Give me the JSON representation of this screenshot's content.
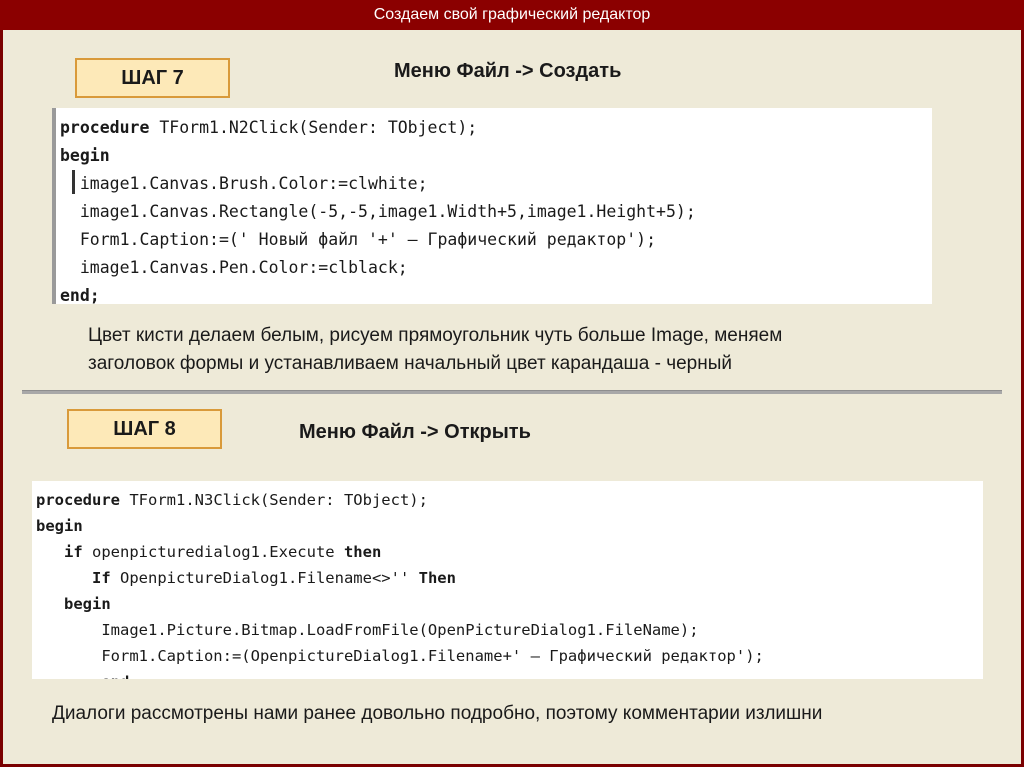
{
  "title": "Создаем свой графический редактор",
  "step7": {
    "label": "ШАГ 7",
    "menu": "Меню Файл -> Создать",
    "code": [
      [
        {
          "t": "procedure",
          "b": true
        },
        {
          "t": " TForm1.N2Click(Sender: TObject);",
          "b": false
        }
      ],
      [
        {
          "t": "begin",
          "b": true
        }
      ],
      [
        {
          "t": "  image1.Canvas.Brush.Color:=clwhite;",
          "b": false
        }
      ],
      [
        {
          "t": "  image1.Canvas.Rectangle(-5,-5,image1.Width+5,image1.Height+5);",
          "b": false
        }
      ],
      [
        {
          "t": "  Form1.Caption:=(' Новый файл '+' – Графический редактор');",
          "b": false
        }
      ],
      [
        {
          "t": "  image1.Canvas.Pen.Color:=clblack;",
          "b": false
        }
      ],
      [
        {
          "t": "end;",
          "b": true
        }
      ]
    ],
    "description_line1": "Цвет кисти делаем белым, рисуем прямоугольник чуть больше Image, меняем",
    "description_line2": "заголовок формы и устанавливаем начальный цвет карандаша - черный"
  },
  "step8": {
    "label": "ШАГ 8",
    "menu": "Меню Файл -> Открыть",
    "code": [
      [
        {
          "t": "procedure",
          "b": true
        },
        {
          "t": " TForm1.N3Click(Sender: TObject);",
          "b": false
        }
      ],
      [
        {
          "t": "begin",
          "b": true
        }
      ],
      [
        {
          "t": "   ",
          "b": false
        },
        {
          "t": "if",
          "b": true
        },
        {
          "t": " openpicturedialog1.Execute ",
          "b": false
        },
        {
          "t": "then",
          "b": true
        }
      ],
      [
        {
          "t": "      ",
          "b": false
        },
        {
          "t": "If",
          "b": true
        },
        {
          "t": " OpenpictureDialog1.Filename<>'' ",
          "b": false
        },
        {
          "t": "Then",
          "b": true
        }
      ],
      [
        {
          "t": "   ",
          "b": false
        },
        {
          "t": "begin",
          "b": true
        }
      ],
      [
        {
          "t": "       Image1.Picture.Bitmap.LoadFromFile(OpenPictureDialog1.FileName);",
          "b": false
        }
      ],
      [
        {
          "t": "       Form1.Caption:=(OpenpictureDialog1.Filename+' – Графический редактор');",
          "b": false
        }
      ],
      [
        {
          "t": "       end;",
          "b": true
        }
      ]
    ],
    "description": "Диалоги рассмотрены нами ранее довольно подробно, поэтому комментарии излишни"
  }
}
